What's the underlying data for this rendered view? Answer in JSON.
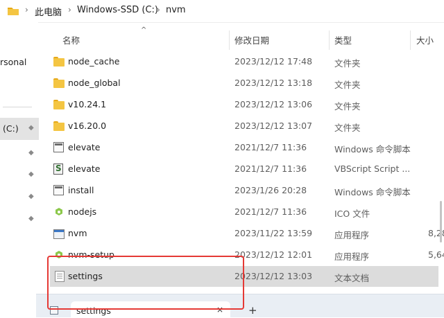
{
  "address": {
    "crumbs": [
      "此电脑",
      "Windows-SSD (C:)",
      "nvm"
    ]
  },
  "nav": {
    "personal_label": "rsonal",
    "drive_label": "(C:)"
  },
  "columns": {
    "name": "名称",
    "date": "修改日期",
    "type": "类型",
    "size": "大小"
  },
  "rows": [
    {
      "name": "node_cache",
      "date": "2023/12/12 17:48",
      "type": "文件夹",
      "size": "",
      "icon": "folder-icon"
    },
    {
      "name": "node_global",
      "date": "2023/12/12 13:18",
      "type": "文件夹",
      "size": "",
      "icon": "folder-icon"
    },
    {
      "name": "v10.24.1",
      "date": "2023/12/12 13:06",
      "type": "文件夹",
      "size": "",
      "icon": "folder-icon"
    },
    {
      "name": "v16.20.0",
      "date": "2023/12/12 13:07",
      "type": "文件夹",
      "size": "",
      "icon": "folder-icon"
    },
    {
      "name": "elevate",
      "date": "2021/12/7 11:36",
      "type": "Windows 命令脚本",
      "size": "",
      "icon": "cmd-script-icon"
    },
    {
      "name": "elevate",
      "date": "2021/12/7 11:36",
      "type": "VBScript Script ...",
      "size": "",
      "icon": "vbscript-icon"
    },
    {
      "name": "install",
      "date": "2023/1/26 20:28",
      "type": "Windows 命令脚本",
      "size": "",
      "icon": "cmd-script-icon"
    },
    {
      "name": "nodejs",
      "date": "2021/12/7 11:36",
      "type": "ICO 文件",
      "size": "",
      "icon": "node-icon"
    },
    {
      "name": "nvm",
      "date": "2023/11/22 13:59",
      "type": "应用程序",
      "size": "8,28",
      "icon": "application-icon"
    },
    {
      "name": "nvm-setup",
      "date": "2023/12/12 12:01",
      "type": "应用程序",
      "size": "5,64",
      "icon": "node-icon"
    },
    {
      "name": "settings",
      "date": "2023/12/12 13:03",
      "type": "文本文档",
      "size": "",
      "icon": "text-document-icon"
    }
  ],
  "tab": {
    "label": "settings",
    "close": "×",
    "add": "+"
  },
  "glyphs": {
    "chevron": "›",
    "sort_up": "^",
    "pin": "📌"
  }
}
